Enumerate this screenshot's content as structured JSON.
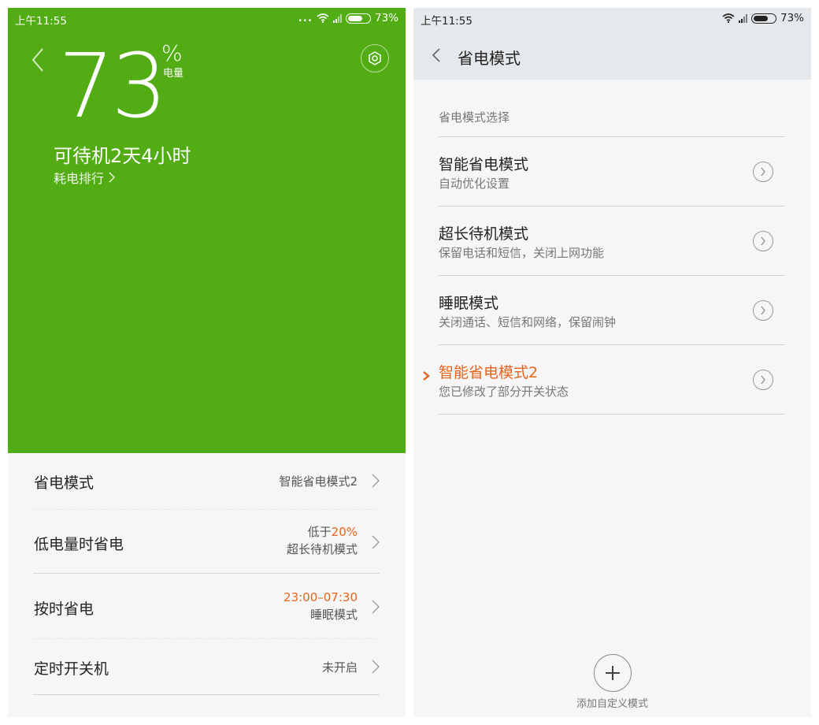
{
  "left_screen": {
    "status_bar": {
      "time": "上午11:55",
      "dots": "...",
      "battery_text": "73%",
      "battery_level_percent": 73
    },
    "battery_value": "73",
    "percent_symbol": "%",
    "battery_label": "电量",
    "standby_text": "可待机2天4小时",
    "ranking_link": "耗电排行",
    "settings": [
      {
        "title": "省电模式",
        "value": "智能省电模式2"
      },
      {
        "title": "低电量时省电",
        "value_prefix": "低于",
        "value_highlight": "20%",
        "value_line2": "超长待机模式"
      },
      {
        "title": "按时省电",
        "value_highlight": "23:00–07:30",
        "value_line2": "睡眠模式"
      },
      {
        "title": "定时开关机",
        "value": "未开启"
      }
    ],
    "colors": {
      "header_green": "#52ad14",
      "accent_orange": "#e8631c"
    }
  },
  "right_screen": {
    "status_bar": {
      "time": "上午11:55",
      "battery_text": "73%",
      "battery_level_percent": 73
    },
    "title": "省电模式",
    "section_label": "省电模式选择",
    "modes": [
      {
        "title": "智能省电模式",
        "subtitle": "自动优化设置",
        "selected": false
      },
      {
        "title": "超长待机模式",
        "subtitle": "保留电话和短信，关闭上网功能",
        "selected": false
      },
      {
        "title": "睡眠模式",
        "subtitle": "关闭通话、短信和网络，保留闹钟",
        "selected": false
      },
      {
        "title": "智能省电模式2",
        "subtitle": "您已修改了部分开关状态",
        "selected": true
      }
    ],
    "add_label": "添加自定义模式"
  }
}
